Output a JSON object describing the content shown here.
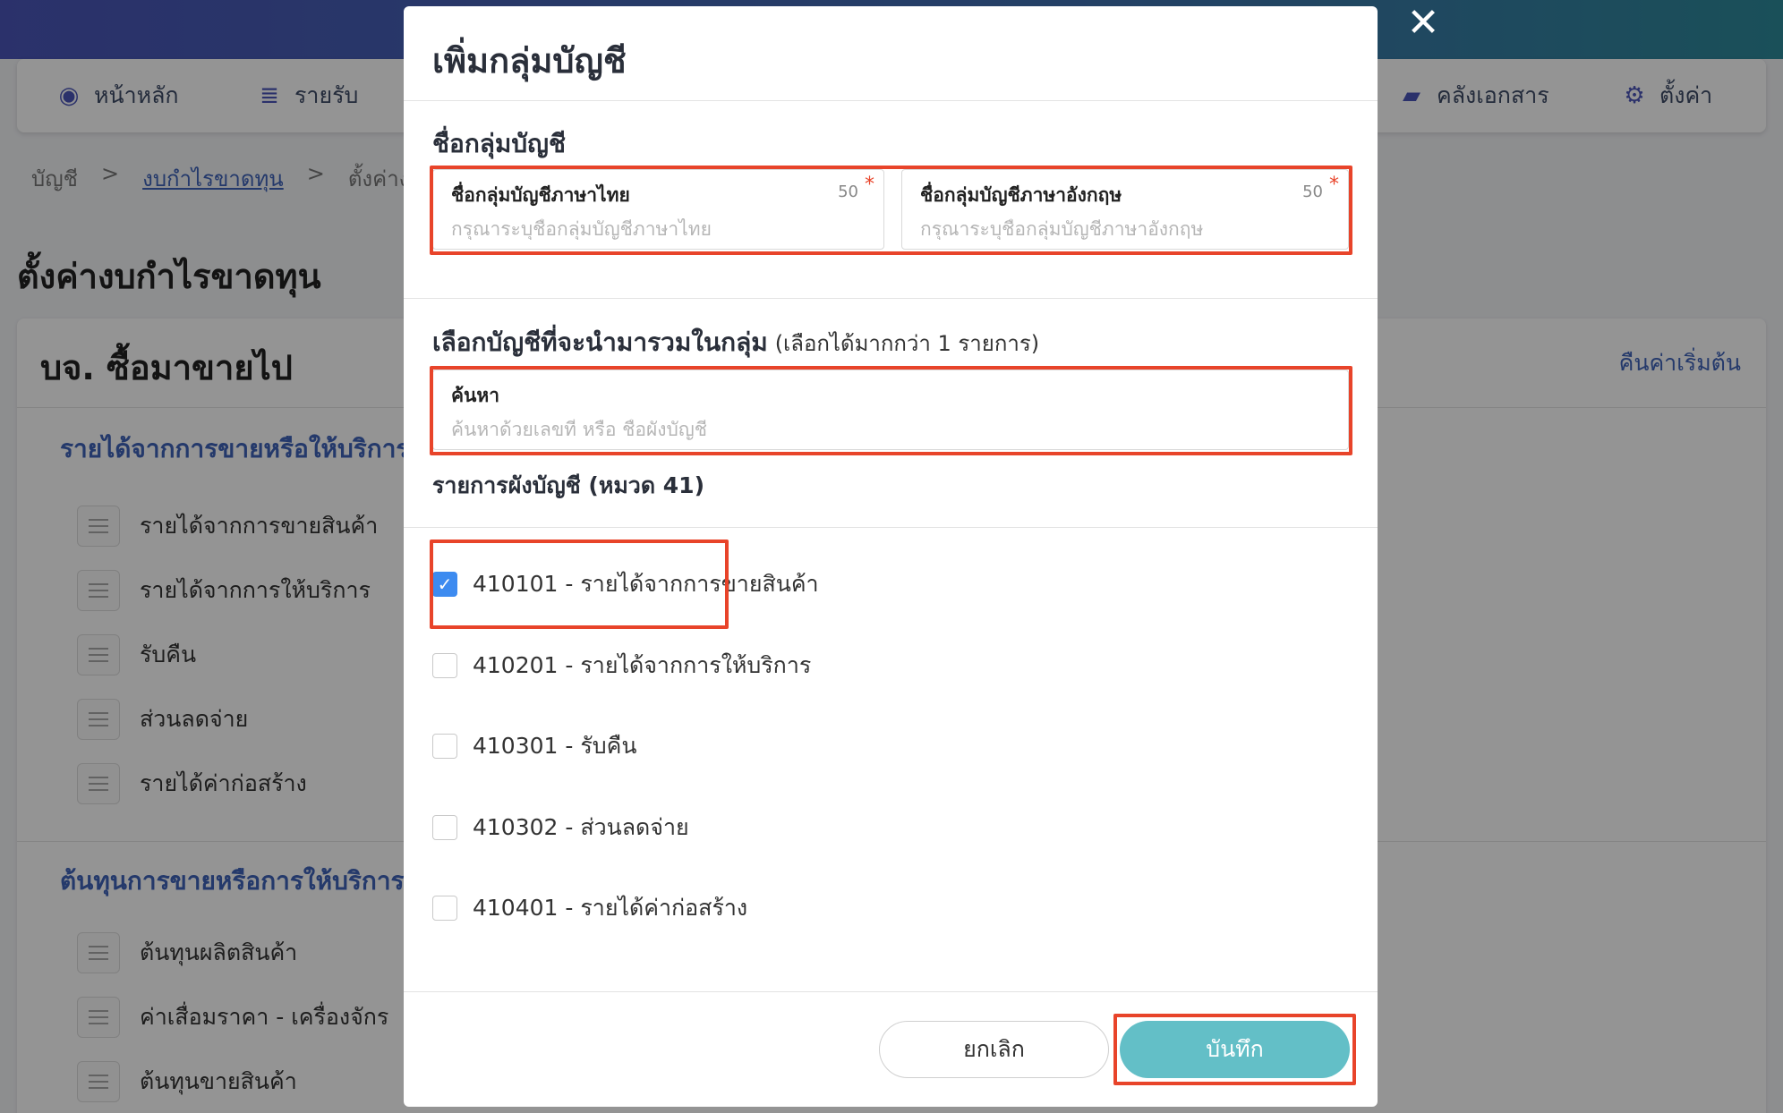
{
  "nav": {
    "home": "หน้าหลัก",
    "income": "รายรับ",
    "documents": "คลังเอกสาร",
    "settings": "ตั้งค่า"
  },
  "breadcrumb": {
    "level1": "บัญชี",
    "sep": ">",
    "level2": "งบกำไรขาดทุน",
    "level3": "ตั้งค่างบ"
  },
  "page": {
    "title": "ตั้งค่างบกำไรขาดทุน",
    "company": "บจ. ซื้อมาขายไป",
    "reset": "คืนค่าเริ่มต้น"
  },
  "sections": [
    {
      "title": "รายได้จากการขายหรือให้บริการ",
      "items": [
        "รายได้จากการขายสินค้า",
        "รายได้จากการให้บริการ",
        "รับคืน",
        "ส่วนลดจ่าย",
        "รายได้ค่าก่อสร้าง"
      ]
    },
    {
      "title": "ต้นทุนการขายหรือการให้บริการ",
      "items": [
        "ต้นทุนผลิตสินค้า",
        "ค่าเสื่อมราคา - เครื่องจักร",
        "ต้นทุนขายสินค้า"
      ]
    }
  ],
  "modal": {
    "title": "เพิ่มกลุ่มบัญชี",
    "group_name_label": "ชื่อกลุ่มบัญชี",
    "thai_field": {
      "label": "ชื่อกลุ่มบัญชีภาษาไทย",
      "count": "50",
      "required": "*",
      "placeholder": "กรุณาระบุชื่อกลุ่มบัญชีภาษาไทย",
      "value": ""
    },
    "english_field": {
      "label": "ชื่อกลุ่มบัญชีภาษาอังกฤษ",
      "count": "50",
      "required": "*",
      "placeholder": "กรุณาระบุชื่อกลุ่มบัญชีภาษาอังกฤษ",
      "value": ""
    },
    "select_label": "เลือกบัญชีที่จะนำมารวมในกลุ่ม",
    "select_hint": "(เลือกได้มากกว่า 1 รายการ)",
    "search": {
      "label": "ค้นหา",
      "placeholder": "ค้นหาด้วยเลขที่ หรือ ชื่อผังบัญชี",
      "value": ""
    },
    "list_title": "รายการผังบัญชี (หมวด 41)",
    "accounts": [
      {
        "label": "410101 - รายได้จากการขายสินค้า",
        "checked": true
      },
      {
        "label": "410201 - รายได้จากการให้บริการ",
        "checked": false
      },
      {
        "label": "410301 - รับคืน",
        "checked": false
      },
      {
        "label": "410302 - ส่วนลดจ่าย",
        "checked": false
      },
      {
        "label": "410401 - รายได้ค่าก่อสร้าง",
        "checked": false
      }
    ],
    "cancel_label": "ยกเลิก",
    "save_label": "บันทึก",
    "close_icon": "close-icon"
  },
  "colors": {
    "accent": "#4a55b8",
    "link": "#3e63b8",
    "save_button": "#63bfc7",
    "highlight": "#e8442a",
    "checkbox": "#3d8bf0"
  }
}
